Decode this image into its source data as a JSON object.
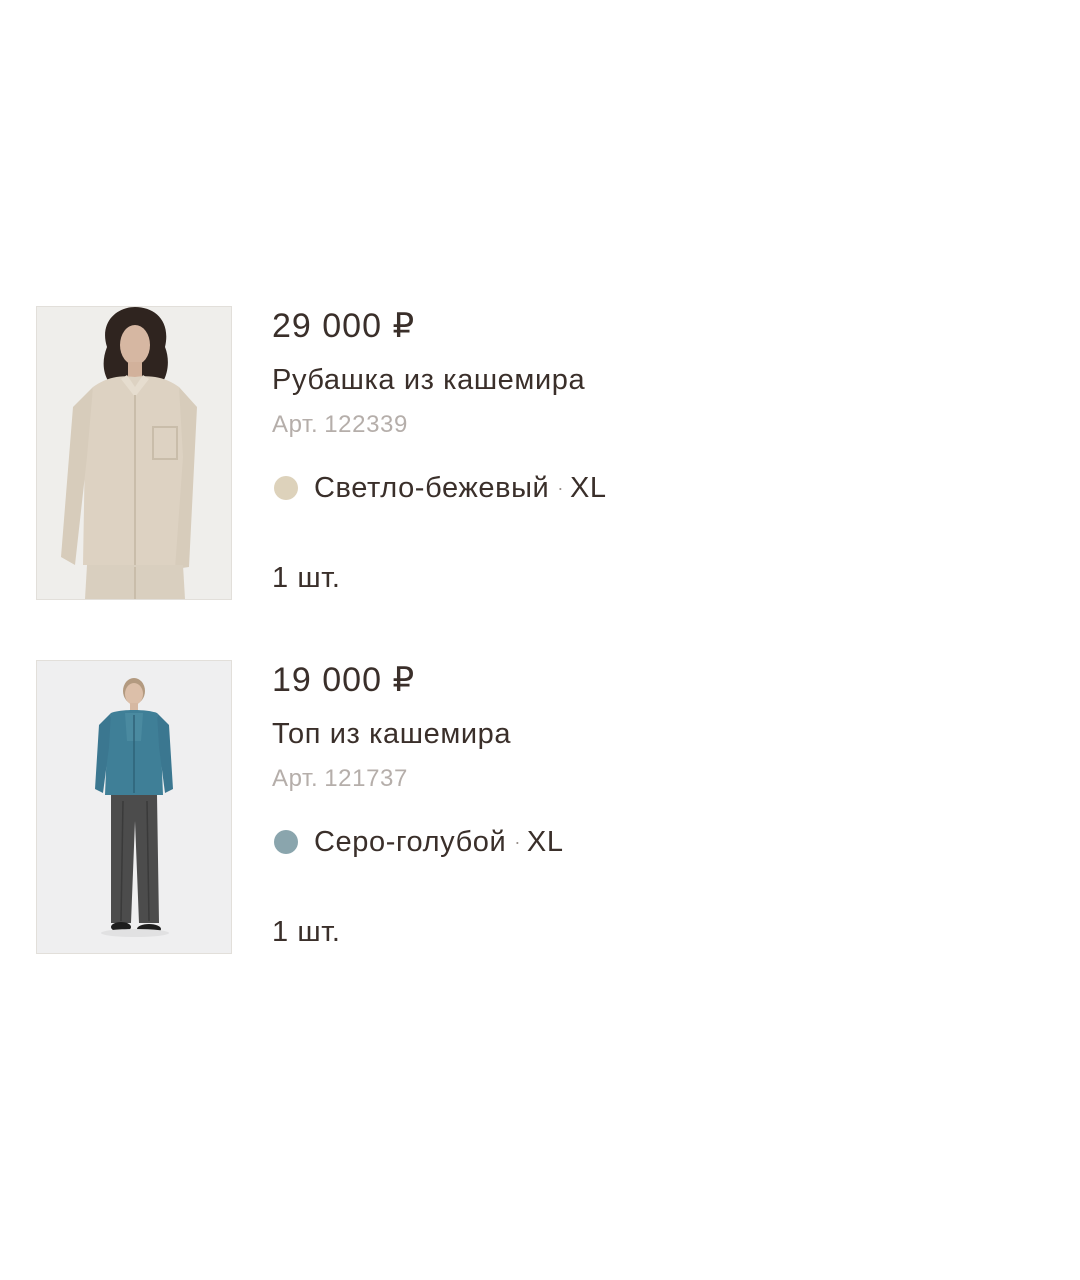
{
  "cart": {
    "items": [
      {
        "price": "29 000 ₽",
        "title": "Рубашка из кашемира",
        "sku_label": "Арт.",
        "sku": "122339",
        "color_name": "Светло-бежевый",
        "color_hex": "#ddd2bb",
        "separator": "·",
        "size": "XL",
        "quantity": "1 шт."
      },
      {
        "price": "19 000 ₽",
        "title": "Топ из кашемира",
        "sku_label": "Арт.",
        "sku": "121737",
        "color_name": "Серо-голубой",
        "color_hex": "#8aa5ad",
        "separator": "·",
        "size": "XL",
        "quantity": "1 шт."
      }
    ]
  }
}
